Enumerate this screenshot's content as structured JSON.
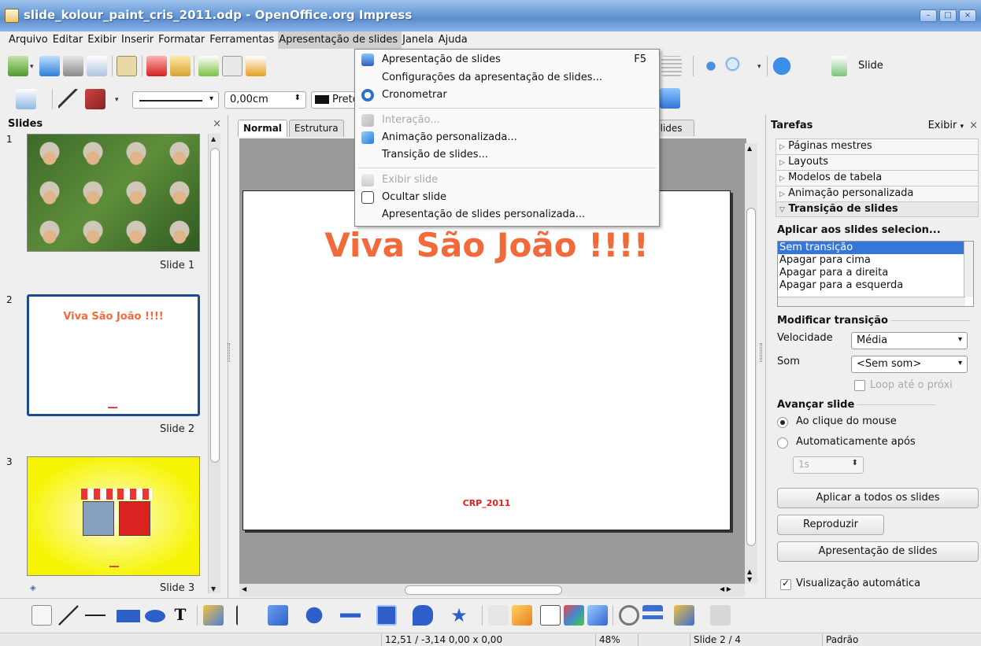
{
  "window": {
    "title": "slide_kolour_paint_cris_2011.odp - OpenOffice.org Impress"
  },
  "menubar": [
    "Arquivo",
    "Editar",
    "Exibir",
    "Inserir",
    "Formatar",
    "Ferramentas",
    "Apresentação de slides",
    "Janela",
    "Ajuda"
  ],
  "toolbar": {
    "slide_label": "Slide",
    "line_width": "0,00cm",
    "color_name": "Preto"
  },
  "dropdown": {
    "items": [
      {
        "label": "Apresentação de slides",
        "shortcut": "F5"
      },
      {
        "label": "Configurações da apresentação de slides...",
        "shortcut": ""
      },
      {
        "label": "Cronometrar",
        "shortcut": ""
      },
      {
        "label": "Interação...",
        "shortcut": ""
      },
      {
        "label": "Animação personalizada...",
        "shortcut": ""
      },
      {
        "label": "Transição de slides...",
        "shortcut": ""
      },
      {
        "label": "Exibir slide",
        "shortcut": ""
      },
      {
        "label": "Ocultar slide",
        "shortcut": ""
      },
      {
        "label": "Apresentação de slides personalizada...",
        "shortcut": ""
      }
    ]
  },
  "slides_pane": {
    "title": "Slides",
    "close": "×",
    "slides": [
      {
        "num": "1",
        "label": "Slide 1"
      },
      {
        "num": "2",
        "label": "Slide 2",
        "thumb_title": "Viva São João !!!!"
      },
      {
        "num": "3",
        "label": "Slide 3"
      }
    ]
  },
  "center": {
    "tabs": [
      "Normal",
      "Estrutura"
    ],
    "tab_right": "Slides",
    "slide_title": "Viva São João !!!!",
    "slide_footer": "CRP_2011"
  },
  "tasks": {
    "title": "Tarefas",
    "view": "Exibir",
    "close": "×",
    "sections": [
      "Páginas mestres",
      "Layouts",
      "Modelos de tabela",
      "Animação personalizada",
      "Transição de slides"
    ],
    "apply_title": "Aplicar aos slides selecion...",
    "transitions": [
      "Sem transição",
      "Apagar para cima",
      "Apagar para a direita",
      "Apagar para a esquerda"
    ],
    "modify_title": "Modificar transição",
    "speed_label": "Velocidade",
    "speed_value": "Média",
    "sound_label": "Som",
    "sound_value": "<Sem som>",
    "loop_label": "Loop até o próxi",
    "advance_title": "Avançar slide",
    "on_click": "Ao clique do mouse",
    "auto_after": "Automaticamente após",
    "auto_value": "1s",
    "apply_all": "Aplicar a todos os slides",
    "play": "Reproduzir",
    "slideshow": "Apresentação de slides",
    "auto_preview": "Visualização automática"
  },
  "statusbar": {
    "position": "12,51 / -3,14",
    "size": "0,00 x 0,00",
    "zoom": "48%",
    "slide": "Slide 2 / 4",
    "master": "Padrão"
  },
  "colors": {
    "accent": "#f26a3a",
    "selection": "#3477d8",
    "footer": "#e02020"
  }
}
